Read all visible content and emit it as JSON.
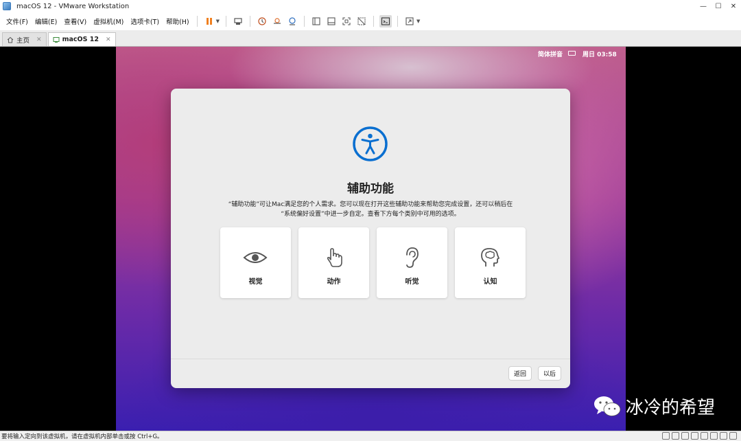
{
  "window": {
    "title": "macOS 12 - VMware Workstation",
    "minimize": "—",
    "maximize": "☐",
    "close": "✕"
  },
  "menu": [
    "文件(F)",
    "编辑(E)",
    "查看(V)",
    "虚拟机(M)",
    "选项卡(T)",
    "帮助(H)"
  ],
  "tabs": [
    {
      "label": "主页",
      "close": "✕"
    },
    {
      "label": "macOS 12",
      "close": "✕"
    }
  ],
  "mac_status": {
    "input_method": "简体拼音",
    "clock": "周日 03:58"
  },
  "dialog": {
    "title": "辅助功能",
    "description_line1": "“辅助功能”可让Mac满足您的个人需求。您可以现在打开这些辅助功能来帮助您完成设置，还可以稍后在",
    "description_line2": "“系统偏好设置”中进一步自定。查看下方每个类别中可用的选项。",
    "categories": [
      {
        "label": "视觉",
        "icon": "eye-icon"
      },
      {
        "label": "动作",
        "icon": "hand-pointer-icon"
      },
      {
        "label": "听觉",
        "icon": "ear-icon"
      },
      {
        "label": "认知",
        "icon": "head-brain-icon"
      }
    ],
    "back_label": "返回",
    "next_label": "以后"
  },
  "watermark": "冰冷的希望",
  "statusbar": {
    "hint": "要将输入定向到该虚拟机，请在虚拟机内部单击或按 Ctrl+G。"
  },
  "colors": {
    "accent": "#0a6fd0",
    "vm_bg": "#000000"
  }
}
